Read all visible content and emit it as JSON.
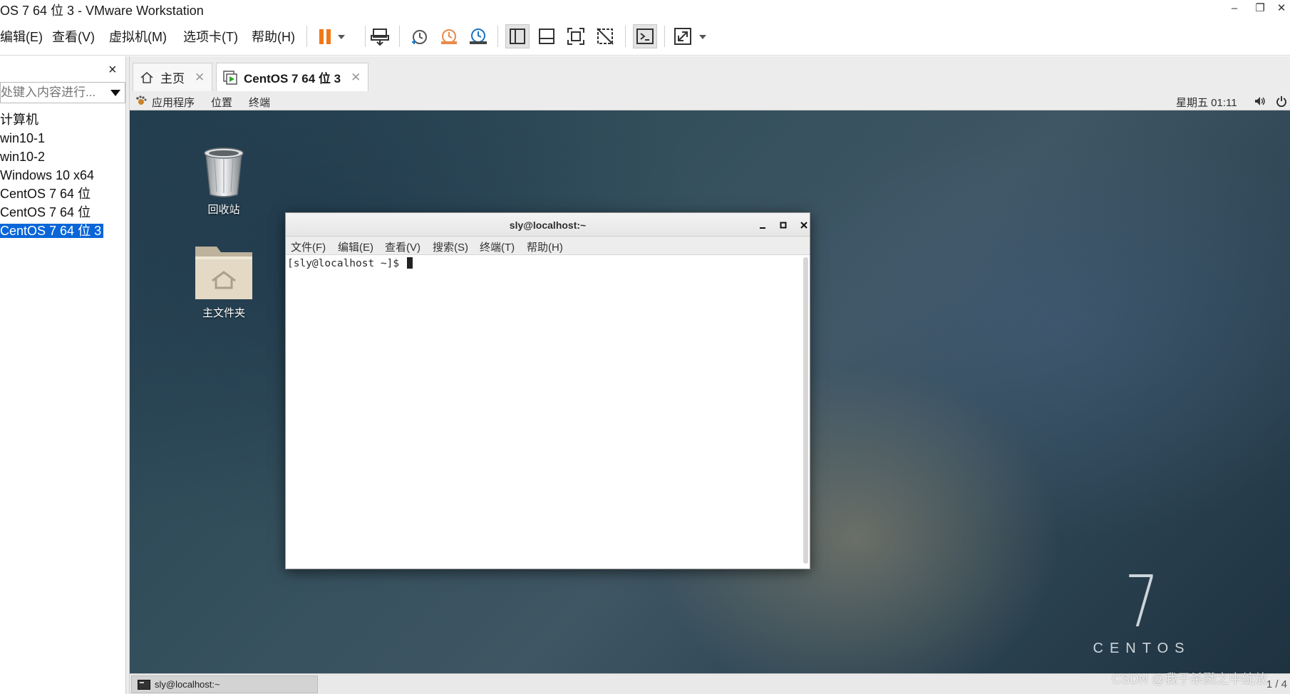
{
  "window": {
    "title": "OS 7 64 位 3 - VMware Workstation",
    "minimize_glyph": "–",
    "restore_glyph": "❐",
    "close_glyph": "✕"
  },
  "menu": {
    "items": [
      "编辑(E)",
      "查看(V)",
      "虚拟机(M)",
      "选项卡(T)",
      "帮助(H)"
    ]
  },
  "toolbar": {
    "accent_color": "#f07818",
    "icons": [
      "pause-icon",
      "send-ctrl-alt-del-icon",
      "snapshot-icon",
      "revert-snapshot-icon",
      "snapshot-manager-icon",
      "library-view-icon",
      "thumbnail-bar-icon",
      "fullscreen-icon",
      "unity-icon",
      "console-view-icon",
      "stretch-guest-icon"
    ]
  },
  "library": {
    "close_glyph": "×",
    "search_placeholder": "处键入内容进行...",
    "items": [
      "计算机",
      "win10-1",
      "win10-2",
      "Windows 10 x64",
      "CentOS 7 64 位",
      "CentOS 7 64 位",
      "CentOS 7 64 位 3"
    ],
    "selected_index": 6,
    "selected_color": "#0a66d8"
  },
  "tabs": [
    {
      "label": "主页",
      "close": "✕",
      "icon": "home-icon"
    },
    {
      "label": "CentOS 7 64 位 3",
      "close": "✕",
      "icon": "vm-running-icon"
    }
  ],
  "guest": {
    "top_bar": {
      "applications": "应用程序",
      "places": "位置",
      "terminal": "终端",
      "clock": "星期五 01:11"
    },
    "desktop_icons": [
      {
        "label": "回收站",
        "icon": "trash-icon"
      },
      {
        "label": "主文件夹",
        "icon": "home-folder-icon"
      }
    ],
    "terminal": {
      "title": "sly@localhost:~",
      "menu": [
        "文件(F)",
        "编辑(E)",
        "查看(V)",
        "搜索(S)",
        "终端(T)",
        "帮助(H)"
      ],
      "prompt": "[sly@localhost ~]$ "
    },
    "branding": {
      "number": "7",
      "word": "CENTOS"
    },
    "taskbar": {
      "item": "sly@localhost:~",
      "page": "1 / 4"
    }
  },
  "watermark": "CSDN @我于杀戮之中绽放"
}
